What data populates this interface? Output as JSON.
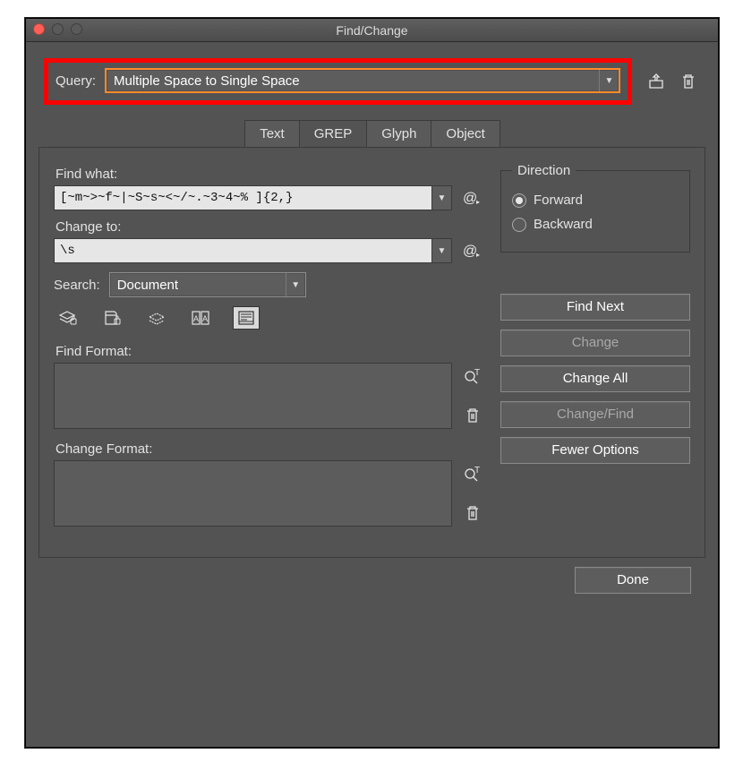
{
  "window": {
    "title": "Find/Change"
  },
  "query": {
    "label": "Query:",
    "selected": "Multiple Space to Single Space"
  },
  "tabs": {
    "text": "Text",
    "grep": "GREP",
    "glyph": "Glyph",
    "object": "Object"
  },
  "fields": {
    "find_what_label": "Find what:",
    "find_what_value": "[~m~>~f~|~S~s~<~/~.~3~4~% ]{2,}",
    "change_to_label": "Change to:",
    "change_to_value": "\\s",
    "search_label": "Search:",
    "search_scope": "Document",
    "find_format_label": "Find Format:",
    "change_format_label": "Change Format:"
  },
  "direction": {
    "legend": "Direction",
    "forward": "Forward",
    "backward": "Backward",
    "selected": "forward"
  },
  "buttons": {
    "find_next": "Find Next",
    "change": "Change",
    "change_all": "Change All",
    "change_find": "Change/Find",
    "fewer_options": "Fewer Options",
    "done": "Done"
  }
}
